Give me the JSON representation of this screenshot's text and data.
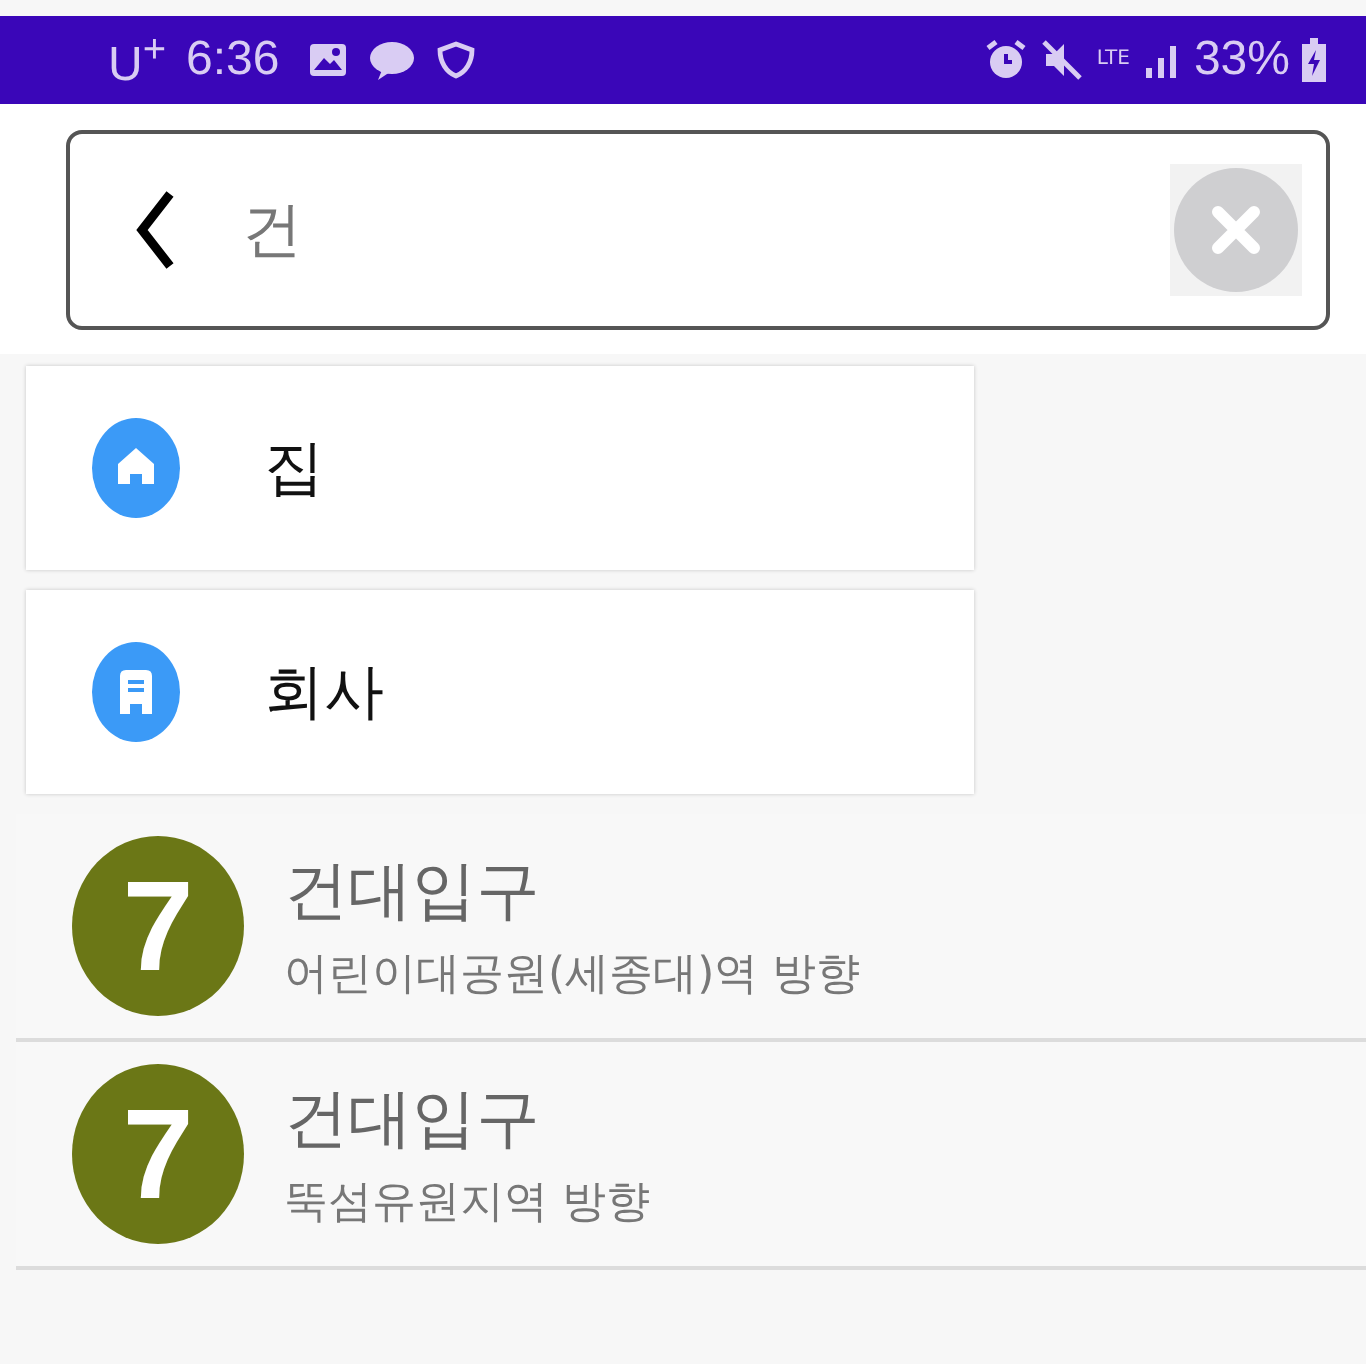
{
  "status_bar": {
    "carrier": "U$^{+}$",
    "time": "6:36",
    "network": "LTE",
    "battery": "33%"
  },
  "search": {
    "value": "건"
  },
  "favorites": [
    {
      "kind": "home",
      "label": "집"
    },
    {
      "kind": "office",
      "label": "회사"
    }
  ],
  "stations": [
    {
      "line": "7",
      "color": "#6b7716",
      "name": "건대입구",
      "direction": "어린이대공원(세종대)역 방향"
    },
    {
      "line": "7",
      "color": "#6b7716",
      "name": "건대입구",
      "direction": "뚝섬유원지역 방향"
    }
  ]
}
